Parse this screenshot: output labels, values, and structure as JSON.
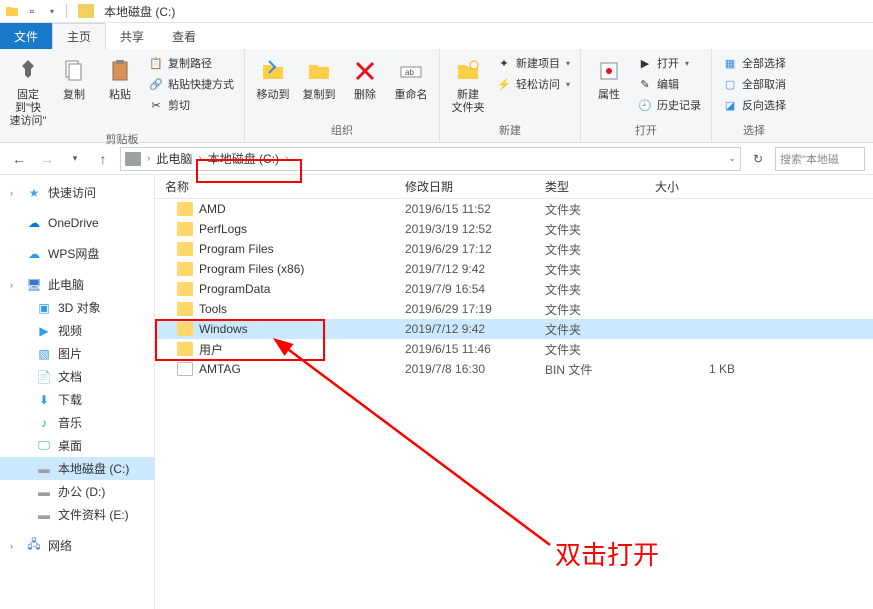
{
  "titlebar": {
    "title": "本地磁盘 (C:)"
  },
  "tabs": {
    "file": "文件",
    "home": "主页",
    "share": "共享",
    "view": "查看"
  },
  "ribbon": {
    "pin": "固定到\"快\n速访问\"",
    "copy": "复制",
    "paste": "粘贴",
    "copypath": "复制路径",
    "pasteshort": "粘贴快捷方式",
    "cut": "剪切",
    "group_clipboard": "剪贴板",
    "moveto": "移动到",
    "copyto": "复制到",
    "delete": "删除",
    "rename": "重命名",
    "group_organize": "组织",
    "newfolder": "新建\n文件夹",
    "newitem": "新建项目",
    "easyaccess": "轻松访问",
    "group_new": "新建",
    "properties": "属性",
    "open": "打开",
    "edit": "编辑",
    "history": "历史记录",
    "group_open": "打开",
    "selectall": "全部选择",
    "selectnone": "全部取消",
    "invertsel": "反向选择",
    "group_select": "选择"
  },
  "address": {
    "crumbs": [
      "此电脑",
      "本地磁盘 (C:)"
    ],
    "search_placeholder": "搜索\"本地磁"
  },
  "sidebar": [
    {
      "label": "快速访问",
      "icon": "star",
      "color": "#3fa9f5",
      "expandable": true,
      "root": true
    },
    {
      "label": "OneDrive",
      "icon": "cloud",
      "color": "#0078d4",
      "root": true,
      "spacer_before": true
    },
    {
      "label": "WPS网盘",
      "icon": "cloud",
      "color": "#2e9bf0",
      "root": true,
      "spacer_before": true
    },
    {
      "label": "此电脑",
      "icon": "pc",
      "color": "#3478c9",
      "expandable": true,
      "root": true,
      "spacer_before": true
    },
    {
      "label": "3D 对象",
      "icon": "3d",
      "color": "#2e9bf0"
    },
    {
      "label": "视频",
      "icon": "video",
      "color": "#2e9bf0"
    },
    {
      "label": "图片",
      "icon": "image",
      "color": "#2e9bf0"
    },
    {
      "label": "文档",
      "icon": "doc",
      "color": "#2e9bf0"
    },
    {
      "label": "下载",
      "icon": "download",
      "color": "#2e9bf0"
    },
    {
      "label": "音乐",
      "icon": "music",
      "color": "#2e9bf0"
    },
    {
      "label": "桌面",
      "icon": "desktop",
      "color": "#2e9bf0"
    },
    {
      "label": "本地磁盘 (C:)",
      "icon": "drive",
      "color": "#9aa0a6",
      "selected": true
    },
    {
      "label": "办公 (D:)",
      "icon": "drive",
      "color": "#9aa0a6"
    },
    {
      "label": "文件资料 (E:)",
      "icon": "drive",
      "color": "#9aa0a6"
    },
    {
      "label": "网络",
      "icon": "network",
      "color": "#3478c9",
      "expandable": true,
      "root": true,
      "spacer_before": true
    }
  ],
  "columns": {
    "name": "名称",
    "date": "修改日期",
    "type": "类型",
    "size": "大小"
  },
  "files": [
    {
      "name": "AMD",
      "date": "2019/6/15 11:52",
      "type": "文件夹",
      "size": "",
      "kind": "folder"
    },
    {
      "name": "PerfLogs",
      "date": "2019/3/19 12:52",
      "type": "文件夹",
      "size": "",
      "kind": "folder"
    },
    {
      "name": "Program Files",
      "date": "2019/6/29 17:12",
      "type": "文件夹",
      "size": "",
      "kind": "folder"
    },
    {
      "name": "Program Files (x86)",
      "date": "2019/7/12 9:42",
      "type": "文件夹",
      "size": "",
      "kind": "folder"
    },
    {
      "name": "ProgramData",
      "date": "2019/7/9 16:54",
      "type": "文件夹",
      "size": "",
      "kind": "folder"
    },
    {
      "name": "Tools",
      "date": "2019/6/29 17:19",
      "type": "文件夹",
      "size": "",
      "kind": "folder"
    },
    {
      "name": "Windows",
      "date": "2019/7/12 9:42",
      "type": "文件夹",
      "size": "",
      "kind": "folder",
      "selected": true
    },
    {
      "name": "用户",
      "date": "2019/6/15 11:46",
      "type": "文件夹",
      "size": "",
      "kind": "folder"
    },
    {
      "name": "AMTAG",
      "date": "2019/7/8 16:30",
      "type": "BIN 文件",
      "size": "1 KB",
      "kind": "file"
    }
  ],
  "annotation": {
    "text": "双击打开"
  }
}
